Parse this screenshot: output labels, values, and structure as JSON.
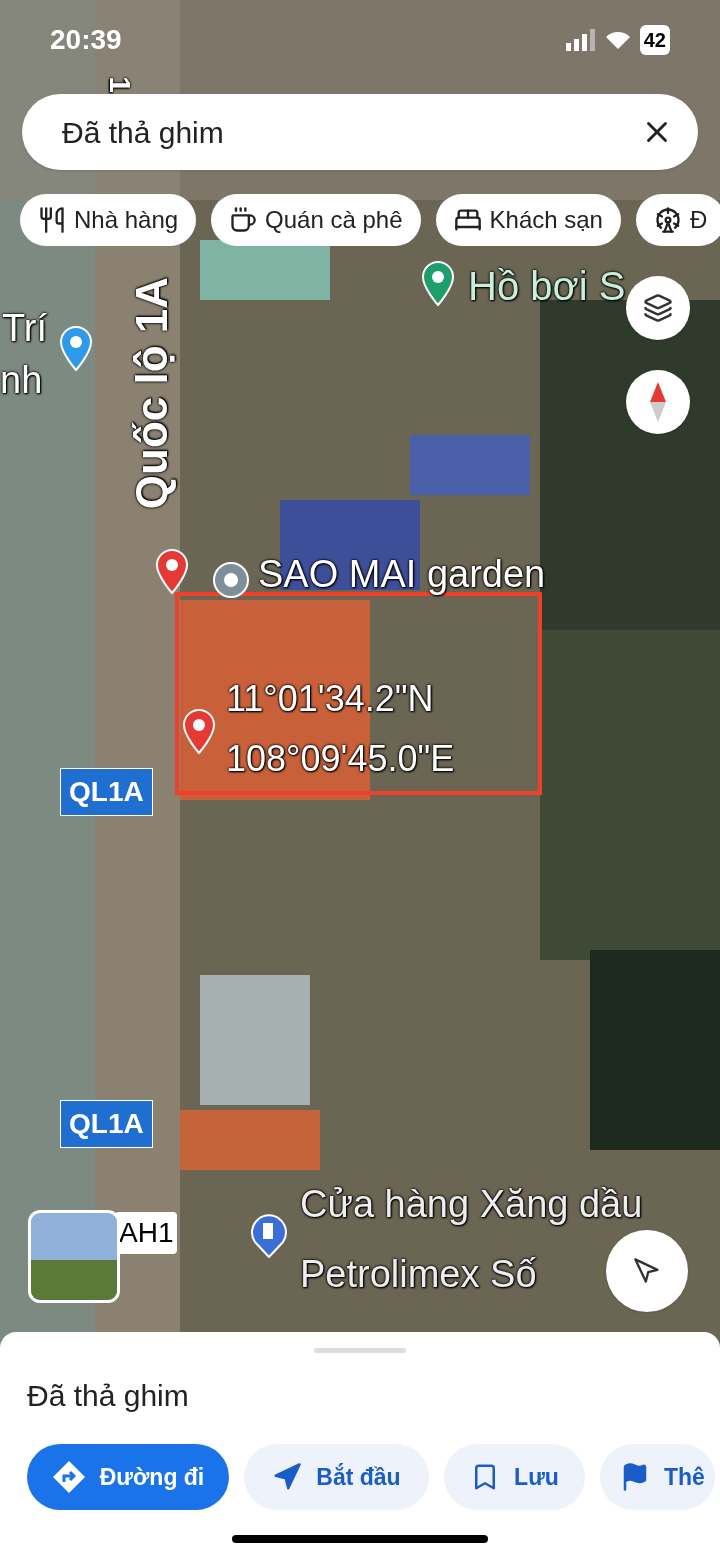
{
  "status_bar": {
    "time": "20:39",
    "battery": "42"
  },
  "search": {
    "value": "Đã thả ghim"
  },
  "chips": [
    {
      "kind": "restaurant",
      "label": "Nhà hàng"
    },
    {
      "kind": "cafe",
      "label": "Quán cà phê"
    },
    {
      "kind": "hotel",
      "label": "Khách sạn"
    },
    {
      "kind": "attraction",
      "label": "Đ"
    }
  ],
  "map": {
    "labels": [
      {
        "kind": "road-number",
        "text": "1"
      },
      {
        "kind": "place",
        "text": "Trí"
      },
      {
        "kind": "place",
        "text": "nh"
      },
      {
        "kind": "road-name",
        "text": "Quốc lộ 1A"
      },
      {
        "kind": "poi-green",
        "text": "Hồ bơi S"
      },
      {
        "kind": "poi",
        "text": "SAO MAI garden"
      },
      {
        "kind": "coordinate",
        "text": "11°01'34.2\"N"
      },
      {
        "kind": "coordinate",
        "text": "108°09'45.0\"E"
      },
      {
        "kind": "route-shield",
        "text": "QL1A"
      },
      {
        "kind": "route-shield",
        "text": "QL1A"
      },
      {
        "kind": "road-tag",
        "text": "AH1"
      },
      {
        "kind": "poi",
        "text": "Cửa hàng Xăng dầu"
      },
      {
        "kind": "poi",
        "text": "Petrolimex Số"
      }
    ]
  },
  "sheet": {
    "title": "Đã thả ghim",
    "actions": [
      {
        "kind": "directions",
        "label": "Đường đi",
        "selected": true
      },
      {
        "kind": "start",
        "label": "Bắt đầu",
        "selected": false
      },
      {
        "kind": "save",
        "label": "Lưu",
        "selected": false
      },
      {
        "kind": "more",
        "label": "Thê",
        "selected": false
      }
    ]
  }
}
